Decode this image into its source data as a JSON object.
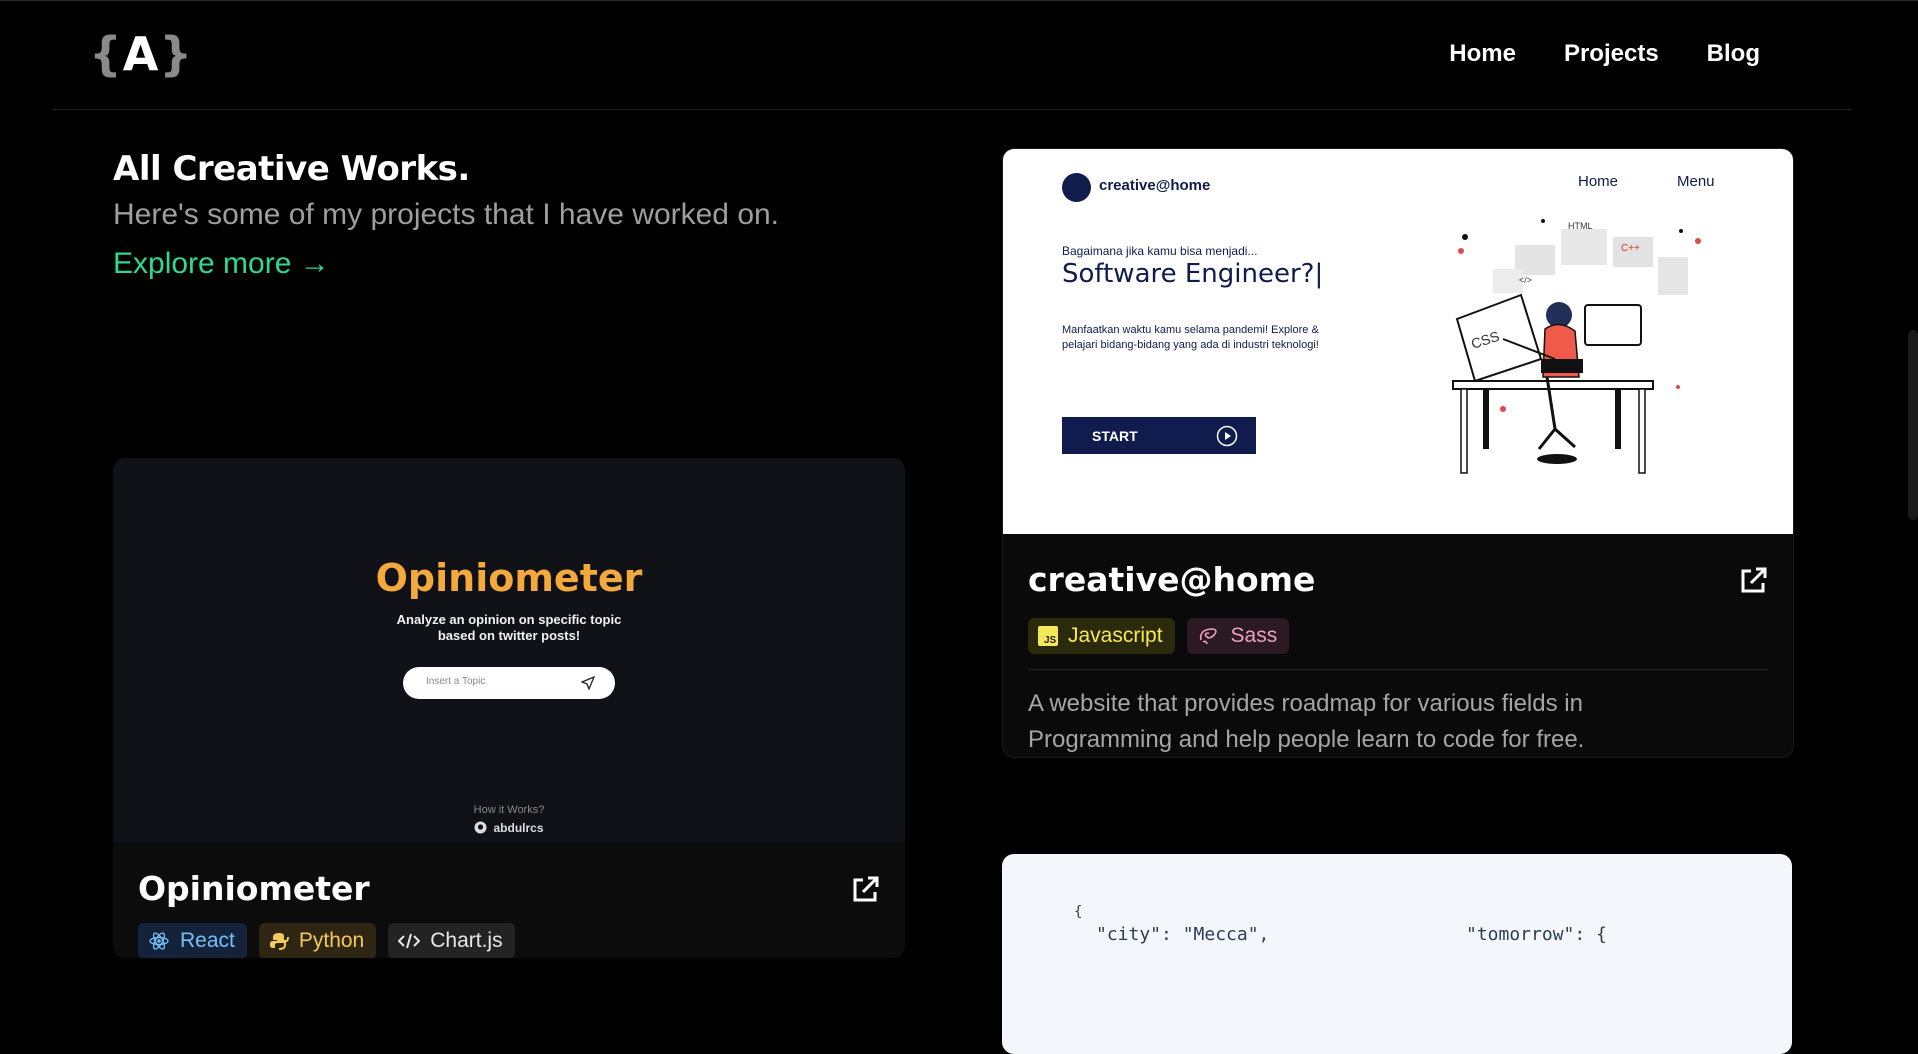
{
  "header": {
    "logo": {
      "left": "{",
      "mid": "A",
      "right": "}"
    },
    "nav": [
      "Home",
      "Projects",
      "Blog"
    ]
  },
  "intro": {
    "title": "All Creative Works.",
    "subtitle": "Here's some of my projects that I have worked on.",
    "explore": "Explore more →"
  },
  "projects": [
    {
      "title": "creative@home",
      "tags": [
        "Javascript",
        "Sass"
      ],
      "description": "A website that provides roadmap for various fields in Programming and help people learn to code for free.",
      "screenshot": {
        "brand": "creative@home",
        "nav": [
          "Home",
          "Menu"
        ],
        "question": "Bagaimana jika kamu bisa menjadi...",
        "headline": "Software Engineer?|",
        "text": "Manfaatkan waktu kamu selama pandemi! Explore & pelajari bidang-bidang yang ada di industri teknologi!",
        "button": "START",
        "illus_labels": [
          "HTML",
          "CSS",
          "C++",
          "</>"
        ]
      }
    },
    {
      "title": "Opiniometer",
      "tags": [
        "React",
        "Python",
        "Chart.js"
      ],
      "screenshot": {
        "title": "Opiniometer",
        "desc": "Analyze an opinion on specific topic based on twitter posts!",
        "placeholder": "Insert a Topic",
        "how": "How it Works?",
        "user": "abdulrcs"
      }
    },
    {
      "screenshot": {
        "code_brace": "{",
        "code_left": "\"city\": \"Mecca\",",
        "code_right": "\"tomorrow\": {"
      }
    }
  ],
  "colors": {
    "accent": "#2fd98f",
    "background": "#000000",
    "navy": "#0f1c4d",
    "opiniometer_orange": "#f4a93c"
  }
}
